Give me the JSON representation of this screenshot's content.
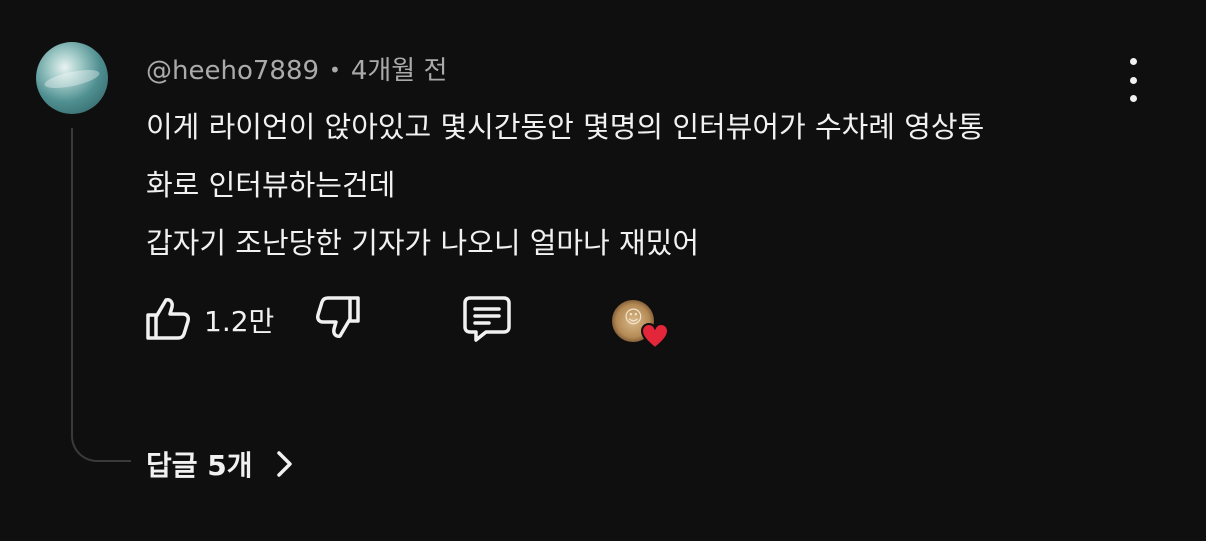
{
  "comment": {
    "username": "@heeho7889",
    "separator": "•",
    "time_ago": "4개월 전",
    "lines": [
      "이게 라이언이 앉아있고 몇시간동안 몇명의 인터뷰어가 수차례 영상통",
      "화로 인터뷰하는건데",
      "갑자기 조난당한 기자가 나오니 얼마나 재밌어"
    ],
    "like_count": "1.2만",
    "replies_label": "답글 5개"
  },
  "icons": {
    "like": "thumbs-up-icon",
    "dislike": "thumbs-down-icon",
    "reply": "comment-bubble-icon",
    "menu": "more-vertical-icon",
    "heart": "heart-icon",
    "replies_chevron": "chevron-right-icon"
  },
  "colors": {
    "background": "#0f0f0f",
    "text": "#f1f1f1",
    "meta": "#aaaaaa",
    "heart": "#e3263a"
  }
}
